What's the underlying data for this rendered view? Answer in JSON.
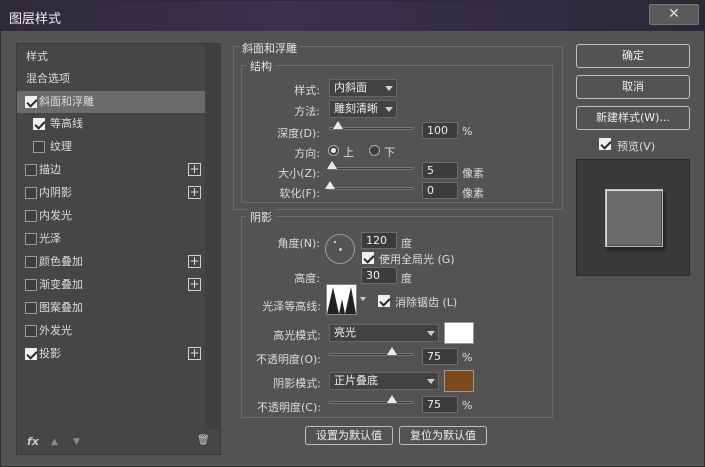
{
  "window": {
    "title": "图层样式",
    "close_glyph": "✕"
  },
  "left_panel": {
    "items": [
      {
        "label": "样式",
        "type": "header"
      },
      {
        "label": "混合选项",
        "type": "header"
      },
      {
        "label": "斜面和浮雕",
        "checked": true,
        "selected": true
      },
      {
        "label": "等高线",
        "checked": true,
        "sub": true
      },
      {
        "label": "纹理",
        "checked": false,
        "sub": true
      },
      {
        "label": "描边",
        "checked": false,
        "plus": true
      },
      {
        "label": "内阴影",
        "checked": false,
        "plus": true
      },
      {
        "label": "内发光",
        "checked": false
      },
      {
        "label": "光泽",
        "checked": false
      },
      {
        "label": "颜色叠加",
        "checked": false,
        "plus": true
      },
      {
        "label": "渐变叠加",
        "checked": false,
        "plus": true
      },
      {
        "label": "图案叠加",
        "checked": false
      },
      {
        "label": "外发光",
        "checked": false
      },
      {
        "label": "投影",
        "checked": true,
        "plus": true
      }
    ],
    "footer": {
      "fx": "fx",
      "up": "▲",
      "down": "▼",
      "trash": "🗑"
    }
  },
  "bevel": {
    "group_title": "斜面和浮雕",
    "structure_title": "结构",
    "style_label": "样式:",
    "style_value": "内斜面",
    "technique_label": "方法:",
    "technique_value": "雕刻清晰",
    "depth_label": "深度(D):",
    "depth_value": "100",
    "depth_unit": "%",
    "depth_fraction": 0.1,
    "direction_label": "方向:",
    "dir_up": "上",
    "dir_down": "下",
    "size_label": "大小(Z):",
    "size_value": "5",
    "size_unit": "像素",
    "size_fraction": 0.02,
    "soften_label": "软化(F):",
    "soften_value": "0",
    "soften_unit": "像素",
    "soften_fraction": 0
  },
  "shading": {
    "title": "阴影",
    "angle_label": "角度(N):",
    "angle_value": "120",
    "angle_unit": "度",
    "global_light_label": "使用全局光 (G)",
    "global_light": true,
    "altitude_label": "高度:",
    "altitude_value": "30",
    "altitude_unit": "度",
    "gloss_label": "光泽等高线:",
    "antialias_label": "消除锯齿 (L)",
    "antialias": true,
    "highlight_mode_label": "高光模式:",
    "highlight_mode_value": "亮光",
    "highlight_color": "#ffffff",
    "highlight_opacity_label": "不透明度(O):",
    "highlight_opacity_value": "75",
    "highlight_opacity_unit": "%",
    "highlight_opacity_fraction": 0.75,
    "shadow_mode_label": "阴影模式:",
    "shadow_mode_value": "正片叠底",
    "shadow_color": "#7a4a1a",
    "shadow_opacity_label": "不透明度(C):",
    "shadow_opacity_value": "75",
    "shadow_opacity_unit": "%",
    "shadow_opacity_fraction": 0.75
  },
  "buttons": {
    "set_default": "设置为默认值",
    "reset_default": "复位为默认值",
    "ok": "确定",
    "cancel": "取消",
    "new_style": "新建样式(W)...",
    "preview_label": "预览(V)"
  }
}
